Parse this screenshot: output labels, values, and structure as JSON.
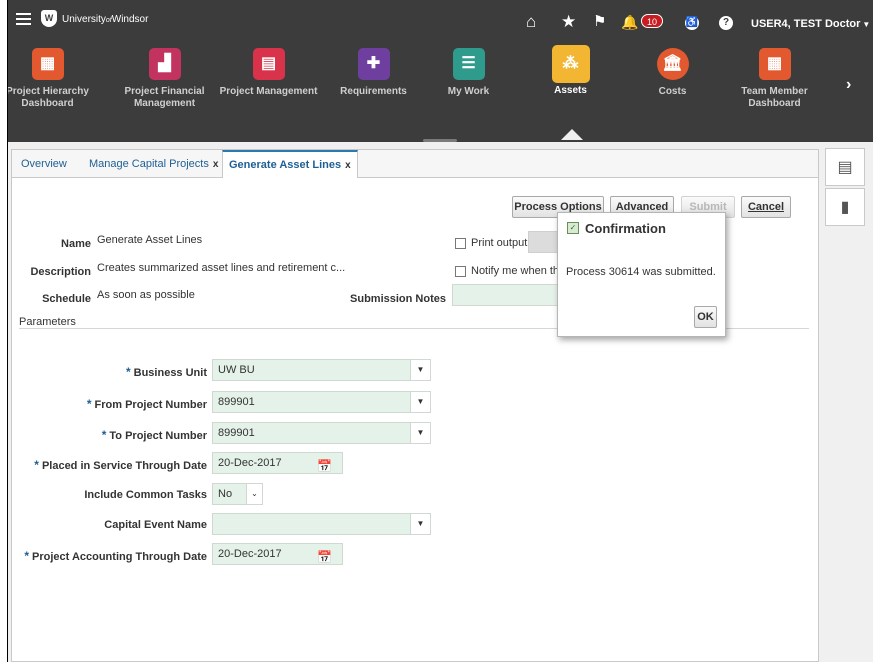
{
  "header": {
    "logo_mark": "W",
    "logo_name": "University",
    "logo_of": "of",
    "logo_place": "Windsor",
    "notification_count": "10",
    "user_label": "USER4, TEST Doctor"
  },
  "springboard": {
    "tiles": [
      {
        "label": "Project Hierarchy Dashboard",
        "color": "#e2592f"
      },
      {
        "label": "Project Financial Management",
        "color": "#c2335f"
      },
      {
        "label": "Project Management",
        "color": "#d8334a"
      },
      {
        "label": "Requirements",
        "color": "#6f3fa0"
      },
      {
        "label": "My Work",
        "color": "#2f9b8c"
      },
      {
        "label": "Assets",
        "color": "#f2b632"
      },
      {
        "label": "Costs",
        "color": "#e2592f"
      },
      {
        "label": "Team Member Dashboard",
        "color": "#e2592f"
      }
    ],
    "active": "Assets"
  },
  "tabs": [
    {
      "label": "Overview",
      "closable": false
    },
    {
      "label": "Manage Capital Projects",
      "closable": true
    },
    {
      "label": "Generate Asset Lines",
      "closable": true,
      "selected": true
    }
  ],
  "tab_close": "x",
  "toolbar": {
    "process_options": "Process Options",
    "advanced": "Advanced",
    "submit": "Submit",
    "cancel": "Cancel"
  },
  "form": {
    "name_label": "Name",
    "name_value": "Generate Asset Lines",
    "description_label": "Description",
    "description_value": "Creates summarized asset lines and retirement c...",
    "schedule_label": "Schedule",
    "schedule_value": "As soon as possible",
    "submission_notes_label": "Submission Notes",
    "print_output_label": "Print output",
    "notify_label": "Notify me when this",
    "parameters_heading": "Parameters"
  },
  "parameters": {
    "required_mark": "*",
    "business_unit_label": "Business Unit",
    "business_unit_value": "UW BU",
    "from_project_label": "From Project Number",
    "from_project_value": "899901",
    "to_project_label": "To Project Number",
    "to_project_value": "899901",
    "placed_in_service_label": "Placed in Service Through Date",
    "placed_in_service_value": "20-Dec-2017",
    "include_common_label": "Include Common Tasks",
    "include_common_value": "No",
    "capital_event_label": "Capital Event Name",
    "capital_event_value": "",
    "accounting_through_label": "Project Accounting Through Date",
    "accounting_through_value": "20-Dec-2017"
  },
  "dialog": {
    "title": "Confirmation",
    "message": "Process 30614 was submitted.",
    "ok": "OK"
  }
}
